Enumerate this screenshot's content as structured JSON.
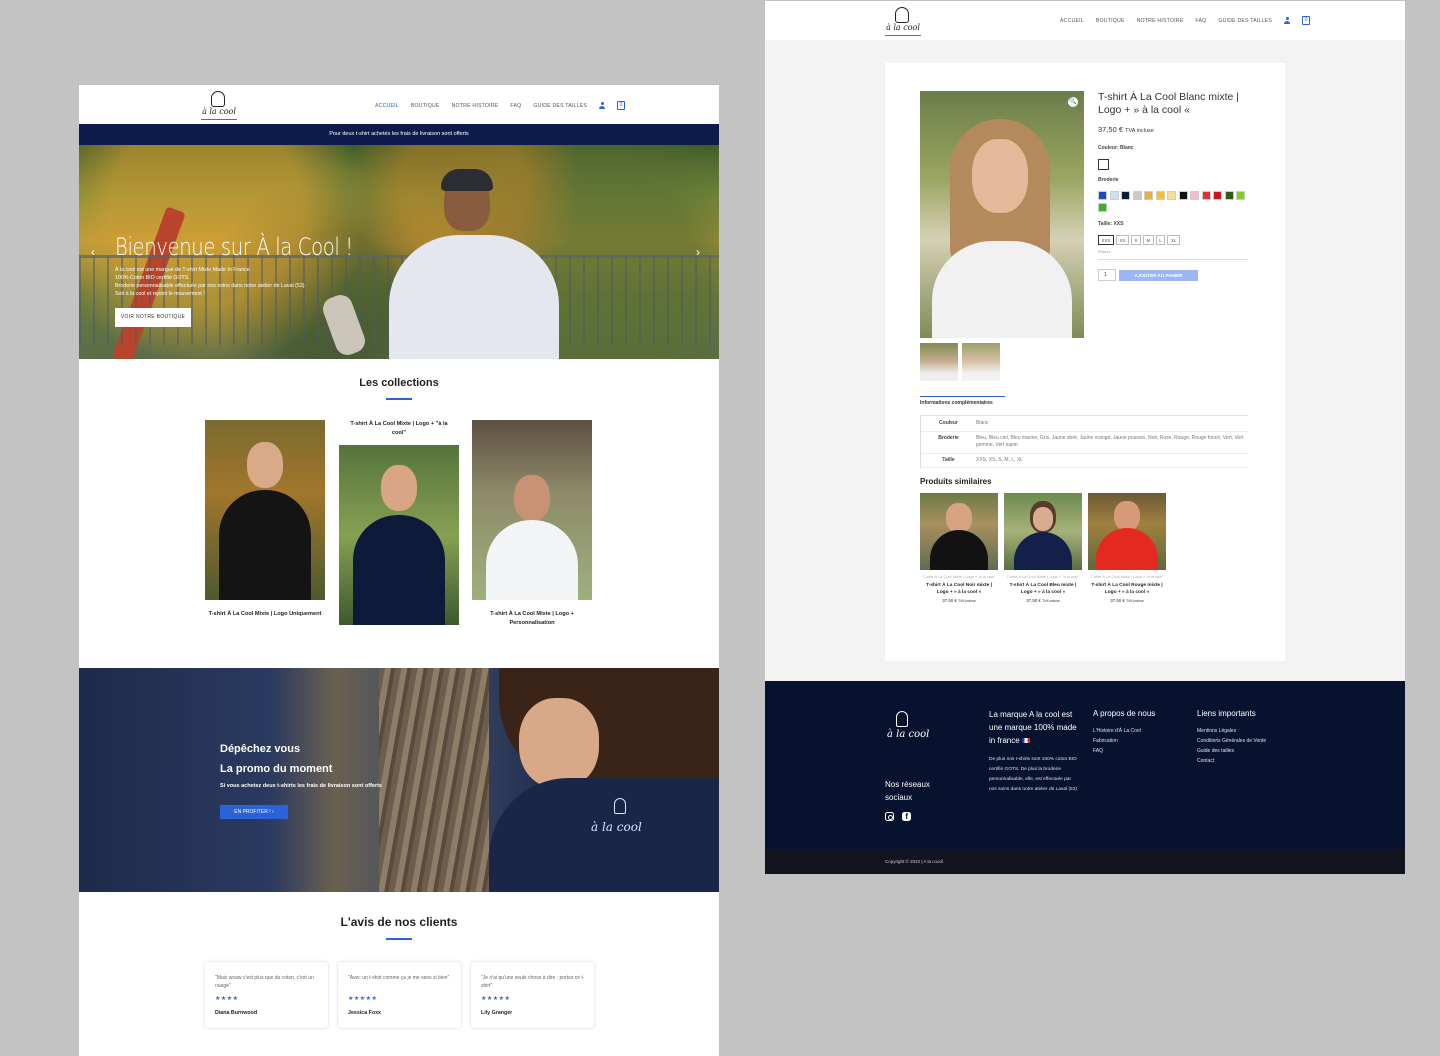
{
  "brand": {
    "logo_text": "à la cool"
  },
  "nav": {
    "items": [
      "ACCUEIL",
      "BOUTIQUE",
      "NOTRE HISTOIRE",
      "FAQ",
      "GUIDE DES TAILLES"
    ],
    "cart_count": "0"
  },
  "home": {
    "promo_bar": "Pour deux t-shirt achetés les frais de livraison sont offerts",
    "hero": {
      "title": "Bienvenue sur À la Cool !",
      "lines": [
        "À la cool est une marque de T-shirt Mixte Made In France",
        "100% Coton BIO certifié GOTS",
        "Broderie personnalisable effectuée par nos soins dans notre atelier de Laval (53)",
        "Soit à la cool et rejoint le mouvement !"
      ],
      "button": "VOIR NOTRE BOUTIQUE",
      "prev_arrow": "‹",
      "next_arrow": "›"
    },
    "collections": {
      "title": "Les collections",
      "items": [
        {
          "name": "T-shirt À La Cool Mixte | Logo Uniquement"
        },
        {
          "name": "T-shirt À La Cool Mixte | Logo + \"à la cool\""
        },
        {
          "name": "T-shirt À La Cool Mixte | Logo + Personnalisation"
        }
      ]
    },
    "promo": {
      "line1": "Dépêchez vous",
      "line2": "La promo du moment",
      "line3": "Si vous achetez deux t-shirts les frais de livraison sont offerts",
      "button": "EN PROFITER !  ›"
    },
    "reviews": {
      "title": "L'avis de nos clients",
      "items": [
        {
          "quote": "\"Mais woaw c'est plus que du coton, c'est un nuage\"",
          "stars": "★★★★",
          "name": "Diana Burnwood"
        },
        {
          "quote": "\"Avec un t-shirt comme ça je me sens si bien\"",
          "stars": "★★★★★",
          "name": "Jessica Foxx"
        },
        {
          "quote": "\"Je n'ai qu'une seule chose à dire : portez ce t-shirt\"",
          "stars": "★★★★★",
          "name": "Lily Granger"
        }
      ]
    }
  },
  "product": {
    "zoom_icon": "🔍",
    "title": "T-shirt À La Cool Blanc mixte | Logo + » à la cool «",
    "price": "37,50 €",
    "tax": "TVA incluse",
    "color_label": "Couleur: Blanc",
    "broderie_label": "Broderie",
    "broderie_colors": [
      "#1f48c4",
      "#cfe0f5",
      "#0c1a3c",
      "#c9c9c9",
      "#e4b044",
      "#f2c13a",
      "#f5dd9a",
      "#111111",
      "#f5bccd",
      "#e0303a",
      "#c01c22",
      "#2e5a1c",
      "#7fd11e",
      "#38b12a"
    ],
    "size_label": "Taille: XXS",
    "sizes": [
      "XXS",
      "XS",
      "S",
      "M",
      "L",
      "XL"
    ],
    "clear": "Effacer",
    "qty": "1",
    "add_to_cart": "AJOUTER AU PANIER",
    "tab": "Informations complémentaires",
    "attributes": [
      {
        "key": "Couleur",
        "value": "Blanc"
      },
      {
        "key": "Broderie",
        "value": "Bleu, Bleu ciel, Bleu marine, Gris, Jaune doré, Jaune orangé, Jaune poussin, Noir, Rose, Rouge, Rouge foncé, Vert, Vert pomme, Vert sapin"
      },
      {
        "key": "Taille",
        "value": "XXS, XS, S, M, L, XL"
      }
    ],
    "similar_title": "Produits similaires",
    "similar": [
      {
        "cat": "T-shirt À La Cool Mixte | Logo + \"à la cool\"",
        "name": "T-shirt À La Cool Noir mixte | Logo + » à la cool «",
        "price": "37,50 €",
        "tax": "TVA incluse"
      },
      {
        "cat": "T-shirt À La Cool Mixte | Logo + \"à la cool\"",
        "name": "T-shirt À La Cool Bleu mixte | Logo + » à la cool «",
        "price": "37,50 €",
        "tax": "TVA incluse"
      },
      {
        "cat": "T-shirt À La Cool Mixte | Logo + \"à la cool\"",
        "name": "T-shirt À La Cool Rouge mixte | Logo + » à la cool «",
        "price": "37,50 €",
        "tax": "TVA incluse"
      }
    ]
  },
  "footer": {
    "logo_text": "à la cool",
    "socials_title": "Nos réseaux sociaux",
    "brand_title": "La marque A la cool est une marque 100% made in france",
    "brand_text": "De plus nos t-shirts sont 100% coton BIO certifié GOTS. De plus la broderie personnalisable, elle, est effectuée par nos soins dans notre atelier de Laval (53)",
    "about_title": "A propos de nous",
    "about_links": [
      "L'Histoire d'À La Cool",
      "Fabrication",
      "FAQ"
    ],
    "links_title": "Liens importants",
    "links": [
      "Mentions Légales",
      "Conditions Générales de Vente",
      "Guide des tailles",
      "Contact"
    ],
    "copyright": "Copyright © 2022 | A la coool"
  }
}
